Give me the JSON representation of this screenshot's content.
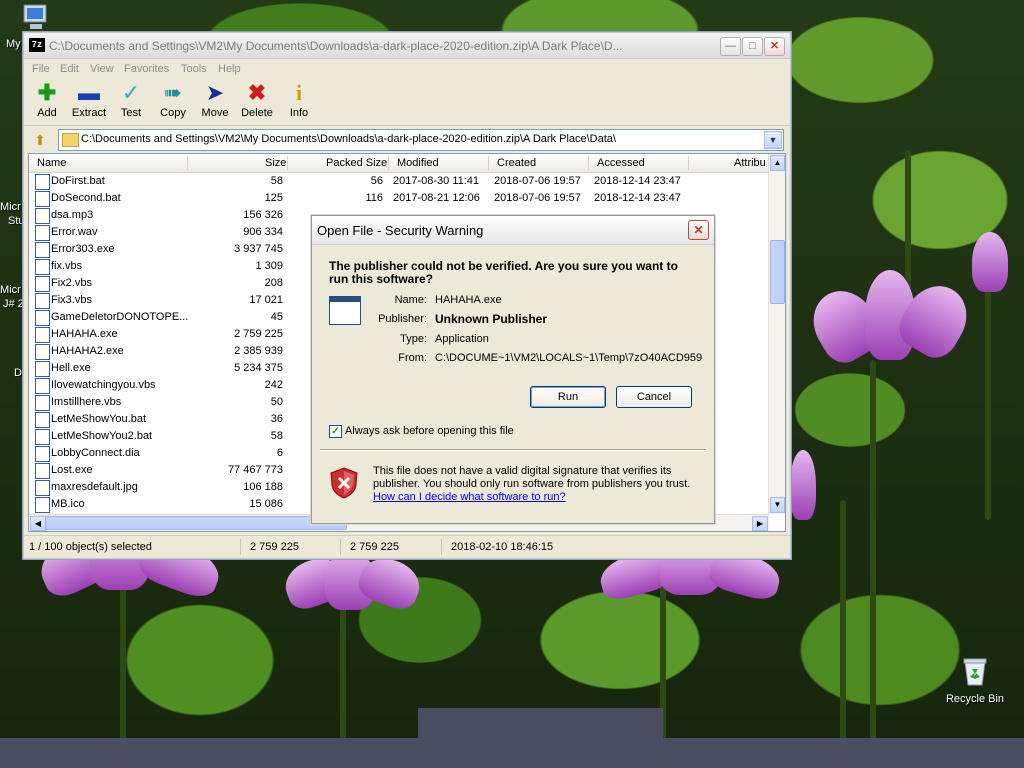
{
  "desktop": {
    "icons": [
      {
        "label": "My",
        "name": "desktop-icon-my-computer"
      },
      {
        "label": "Recycle Bin",
        "name": "desktop-icon-recycle-bin"
      }
    ],
    "edge_fragments": [
      "Micr",
      "Stu",
      "Micr",
      "J# 2",
      "D"
    ]
  },
  "fm": {
    "app_icon": "7z",
    "title": "C:\\Documents and Settings\\VM2\\My Documents\\Downloads\\a-dark-place-2020-edition.zip\\A Dark Place\\D...",
    "menu": [
      "File",
      "Edit",
      "View",
      "Favorites",
      "Tools",
      "Help"
    ],
    "toolbar": [
      {
        "label": "Add",
        "icon": "add-icon",
        "color": "#1a9a1a"
      },
      {
        "label": "Extract",
        "icon": "extract-icon",
        "color": "#1b3fb5"
      },
      {
        "label": "Test",
        "icon": "test-icon",
        "color": "#21b3c7"
      },
      {
        "label": "Copy",
        "icon": "copy-icon",
        "color": "#1f8fa0"
      },
      {
        "label": "Move",
        "icon": "move-icon",
        "color": "#1b2f9a"
      },
      {
        "label": "Delete",
        "icon": "delete-icon",
        "color": "#d11a1a"
      },
      {
        "label": "Info",
        "icon": "info-icon",
        "color": "#c9a10f"
      }
    ],
    "address": "C:\\Documents and Settings\\VM2\\My Documents\\Downloads\\a-dark-place-2020-edition.zip\\A Dark Place\\Data\\",
    "columns": [
      "Name",
      "Size",
      "Packed Size",
      "Modified",
      "Created",
      "Accessed",
      "Attribu"
    ],
    "rows": [
      {
        "name": "DoFirst.bat",
        "size": "58",
        "packed": "56",
        "modified": "2017-08-30 11:41",
        "created": "2018-07-06 19:57",
        "accessed": "2018-12-14 23:47"
      },
      {
        "name": "DoSecond.bat",
        "size": "125",
        "packed": "116",
        "modified": "2017-08-21 12:06",
        "created": "2018-07-06 19:57",
        "accessed": "2018-12-14 23:47"
      },
      {
        "name": "dsa.mp3",
        "size": "156 326",
        "packed": "",
        "modified": "",
        "created": "",
        "accessed": ""
      },
      {
        "name": "Error.wav",
        "size": "906 334",
        "packed": "",
        "modified": "",
        "created": "",
        "accessed": ""
      },
      {
        "name": "Error303.exe",
        "size": "3 937 745",
        "packed": "",
        "modified": "",
        "created": "",
        "accessed": ""
      },
      {
        "name": "fix.vbs",
        "size": "1 309",
        "packed": "",
        "modified": "",
        "created": "",
        "accessed": ""
      },
      {
        "name": "Fix2.vbs",
        "size": "208",
        "packed": "",
        "modified": "",
        "created": "",
        "accessed": ""
      },
      {
        "name": "Fix3.vbs",
        "size": "17 021",
        "packed": "",
        "modified": "",
        "created": "",
        "accessed": ""
      },
      {
        "name": "GameDeletorDONOTOPE...",
        "size": "45",
        "packed": "",
        "modified": "",
        "created": "",
        "accessed": ""
      },
      {
        "name": "HAHAHA.exe",
        "size": "2 759 225",
        "packed": "",
        "modified": "",
        "created": "",
        "accessed": ""
      },
      {
        "name": "HAHAHA2.exe",
        "size": "2 385 939",
        "packed": "",
        "modified": "",
        "created": "",
        "accessed": ""
      },
      {
        "name": "Hell.exe",
        "size": "5 234 375",
        "packed": "",
        "modified": "",
        "created": "",
        "accessed": ""
      },
      {
        "name": "Ilovewatchingyou.vbs",
        "size": "242",
        "packed": "",
        "modified": "",
        "created": "",
        "accessed": ""
      },
      {
        "name": "Imstillhere.vbs",
        "size": "50",
        "packed": "",
        "modified": "",
        "created": "",
        "accessed": ""
      },
      {
        "name": "LetMeShowYou.bat",
        "size": "36",
        "packed": "",
        "modified": "",
        "created": "",
        "accessed": ""
      },
      {
        "name": "LetMeShowYou2.bat",
        "size": "58",
        "packed": "",
        "modified": "",
        "created": "",
        "accessed": ""
      },
      {
        "name": "LobbyConnect.dia",
        "size": "6",
        "packed": "",
        "modified": "",
        "created": "",
        "accessed": ""
      },
      {
        "name": "Lost.exe",
        "size": "77 467 773",
        "packed": "",
        "modified": "",
        "created": "",
        "accessed": ""
      },
      {
        "name": "maxresdefault.jpg",
        "size": "106 188",
        "packed": "",
        "modified": "",
        "created": "",
        "accessed": ""
      },
      {
        "name": "MB.ico",
        "size": "15 086",
        "packed": "",
        "modified": "",
        "created": "",
        "accessed": ""
      }
    ],
    "status": {
      "selected": "1 / 100 object(s) selected",
      "size": "2 759 225",
      "packed": "2 759 225",
      "date": "2018-02-10 18:46:15"
    }
  },
  "dialog": {
    "title": "Open File - Security Warning",
    "heading": "The publisher could not be verified.  Are you sure you want to run this software?",
    "fields": [
      {
        "key": "Name:",
        "value": "HAHAHA.exe",
        "bold": false
      },
      {
        "key": "Publisher:",
        "value": "Unknown Publisher",
        "bold": true
      },
      {
        "key": "Type:",
        "value": "Application",
        "bold": false
      },
      {
        "key": "From:",
        "value": "C:\\DOCUME~1\\VM2\\LOCALS~1\\Temp\\7zO40ACD959",
        "bold": false
      }
    ],
    "run_label": "Run",
    "cancel_label": "Cancel",
    "checkbox_label": "Always ask before opening this file",
    "checkbox_checked": true,
    "warning_text": "This file does not have a valid digital signature that verifies its publisher.  You should only run software from publishers you trust.",
    "link_text": "How can I decide what software to run?"
  }
}
